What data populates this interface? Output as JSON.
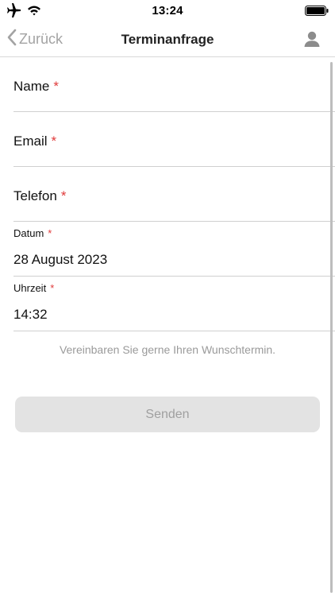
{
  "status_bar": {
    "time": "13:24",
    "icons": [
      "airplane-icon",
      "wifi-icon",
      "battery-icon"
    ]
  },
  "nav": {
    "back_label": "Zurück",
    "title": "Terminanfrage",
    "right_icon": "user-icon"
  },
  "form": {
    "name_label": "Name",
    "email_label": "Email",
    "phone_label": "Telefon",
    "date_label": "Datum",
    "date_value": "28 August 2023",
    "time_label": "Uhrzeit",
    "time_value": "14:32",
    "required_mark": "*"
  },
  "hint": "Vereinbaren Sie gerne Ihren Wunschtermin.",
  "send_label": "Senden",
  "colors": {
    "required": "#e03a3a",
    "back_text": "#a3a3a3",
    "button_bg": "#e3e3e3",
    "button_text": "#a0a0a0",
    "hint_text": "#9a9a9a"
  }
}
